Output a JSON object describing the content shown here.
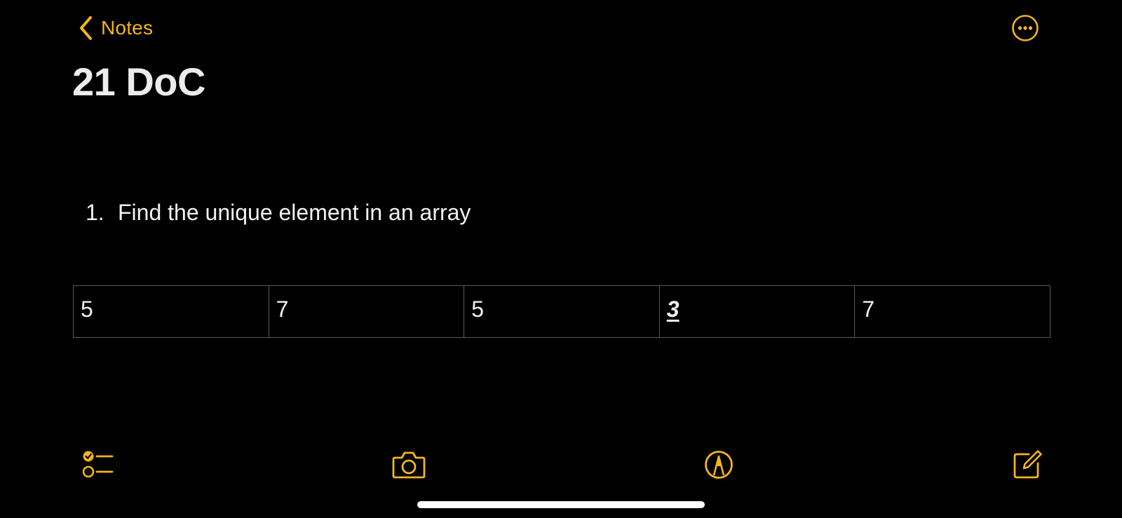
{
  "nav": {
    "back_label": "Notes",
    "back_icon": "chevron-left-icon",
    "more_icon": "ellipsis-circle-icon"
  },
  "note": {
    "title": "21 DoC",
    "list_items": [
      {
        "number": "1.",
        "text": "Find the unique element in an array"
      }
    ],
    "table": {
      "cells": [
        "5",
        "7",
        "5",
        "3",
        "7"
      ],
      "styled_cell_index": 3
    }
  },
  "toolbar": {
    "checklist_icon": "checklist-icon",
    "camera_icon": "camera-icon",
    "markup_icon": "markup-pen-icon",
    "compose_icon": "compose-icon"
  },
  "colors": {
    "accent": "#f3b51b",
    "background": "#000000",
    "text": "#f2f2f2",
    "grid": "#5a5a5a"
  }
}
